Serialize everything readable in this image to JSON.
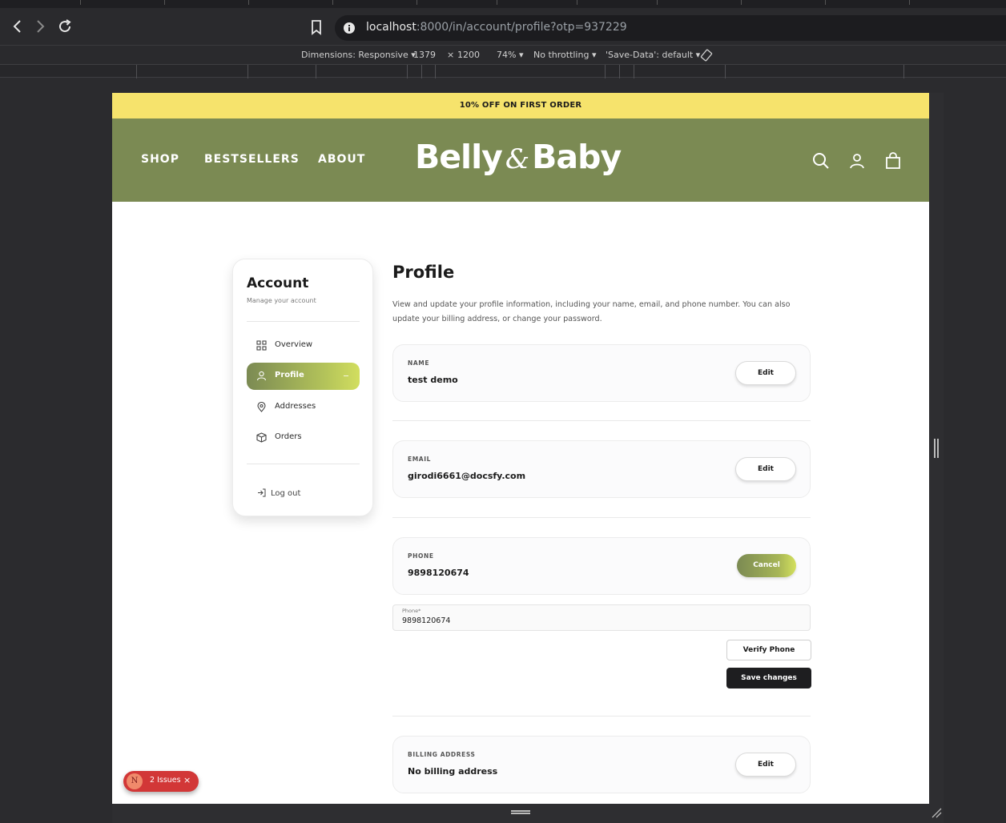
{
  "browser": {
    "url_host": "localhost",
    "url_rest": ":8000/in/account/profile?otp=937229"
  },
  "devtools": {
    "dimensions_label": "Dimensions: Responsive ▾",
    "width": "1379",
    "times": "×",
    "height": "1200",
    "zoom": "74% ▾",
    "throttling": "No throttling ▾",
    "save_data": "'Save-Data': default ▾"
  },
  "promo": {
    "text": "10% OFF ON FIRST ORDER"
  },
  "header": {
    "nav": [
      "SHOP",
      "BESTSELLERS",
      "ABOUT"
    ],
    "logo_left": "Belly",
    "logo_amp": "&",
    "logo_right": "Baby"
  },
  "sidebar": {
    "title": "Account",
    "subtitle": "Manage your account",
    "items": [
      {
        "label": "Overview",
        "icon": "grid-icon"
      },
      {
        "label": "Profile",
        "icon": "user-icon",
        "active": true
      },
      {
        "label": "Addresses",
        "icon": "map-pin-icon"
      },
      {
        "label": "Orders",
        "icon": "box-icon"
      }
    ],
    "logout": "Log out"
  },
  "profile": {
    "title": "Profile",
    "description": "View and update your profile information, including your name, email, and phone number. You can also update your billing address, or change your password.",
    "fields": {
      "name": {
        "label": "NAME",
        "value": "test demo",
        "action": "Edit"
      },
      "email": {
        "label": "EMAIL",
        "value": "girodi6661@docsfy.com",
        "action": "Edit"
      },
      "phone": {
        "label": "PHONE",
        "value": "9898120674",
        "action": "Cancel"
      },
      "billing": {
        "label": "BILLING ADDRESS",
        "value": "No billing address",
        "action": "Edit"
      }
    },
    "phone_input": {
      "label": "Phone*",
      "value": "9898120674"
    },
    "verify_label": "Verify Phone",
    "save_label": "Save changes"
  },
  "issues": {
    "badge": "N",
    "text": "2 Issues",
    "close": "×"
  },
  "colors": {
    "promo": "#f6e36c",
    "header": "#7b8a53",
    "accent_end": "#d2de5f"
  }
}
